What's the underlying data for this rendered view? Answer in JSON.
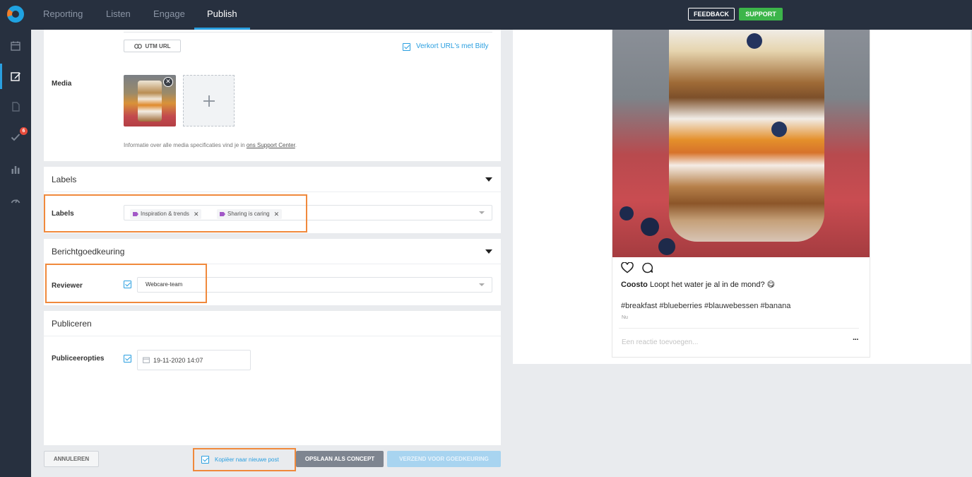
{
  "topbar": {
    "tabs": [
      {
        "label": "Reporting"
      },
      {
        "label": "Listen"
      },
      {
        "label": "Engage"
      },
      {
        "label": "Publish"
      }
    ],
    "feedback_label": "FEEDBACK",
    "support_label": "SUPPORT"
  },
  "sidebar": {
    "items": [
      "calendar-icon",
      "compose-icon",
      "document-icon",
      "approval-check-icon",
      "bar-chart-icon",
      "gauge-icon"
    ],
    "approval_badge": "6"
  },
  "media_section": {
    "utm_label": "UTM URL",
    "shorten_label": "Verkort URL's met Bitly",
    "media_label": "Media",
    "info_text": "Informatie over alle media specificaties vind je in ",
    "info_link": "ons Support Center",
    "info_end": "."
  },
  "labels_section": {
    "header": "Labels",
    "field_label": "Labels",
    "chips": [
      "Inspiration & trends",
      "Sharing is caring"
    ]
  },
  "approval_section": {
    "header": "Berichtgoedkeuring",
    "field_label": "Reviewer",
    "reviewer_value": "Webcare-team"
  },
  "publish_section": {
    "header": "Publiceren",
    "field_label": "Publiceeropties",
    "date_value": "19-11-2020 14:07"
  },
  "footer": {
    "cancel_label": "ANNULEREN",
    "copy_label": "Kopiëer naar nieuwe post",
    "save_draft_label": "OPSLAAN ALS CONCEPT",
    "send_approval_label": "VERZEND VOOR GOEDKEURING"
  },
  "preview": {
    "username": "Coosto",
    "caption": "Loopt het water je al in de mond? 😋",
    "hashtags": "#breakfast #blueberries #blauwebessen #banana",
    "time": "Nu",
    "comment_placeholder": "Een reactie toevoegen...",
    "more_label": "···"
  },
  "colors": {
    "accent": "#2a9fe0",
    "highlight": "#f0893c",
    "support_green": "#3cb54a",
    "nav_bg": "#27303f",
    "label_purple": "#a258c7"
  }
}
